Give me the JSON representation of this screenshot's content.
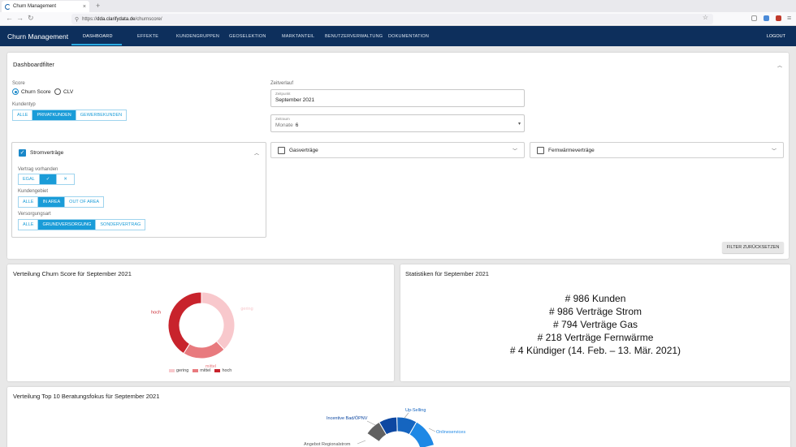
{
  "browser": {
    "tab_title": "Churn Management",
    "tab_close": "×",
    "new_tab": "+",
    "url_prefix": "https://",
    "url_domain": "dda.clarifydata.de",
    "url_path": "/churnscore/"
  },
  "nav": {
    "brand": "Churn Management",
    "items": [
      "DASHBOARD",
      "EFFEKTE",
      "KUNDENGRUPPEN",
      "GEOSELEKTION",
      "MARKTANTEIL",
      "BENUTZERVERWALTUNG",
      "DOKUMENTATION"
    ],
    "logout": "LOGOUT"
  },
  "filter": {
    "title": "Dashboardfilter",
    "score_label": "Score",
    "score_options": [
      "Churn Score",
      "CLV"
    ],
    "score_selected": "Churn Score",
    "kundentyp_label": "Kundentyp",
    "kundentyp_options": [
      "ALLE",
      "PRIVATKUNDEN",
      "GEWERBEKUNDEN"
    ],
    "kundentyp_selected": "PRIVATKUNDEN",
    "zeitverlauf_label": "Zeitverlauf",
    "zeitpunkt_label": "Zeitpunkt",
    "zeitpunkt_value": "September 2021",
    "zeitraum_label": "Zeitraum",
    "zeitraum_prefix": "Monate",
    "zeitraum_value": "6",
    "strom": {
      "title": "Stromverträge",
      "checked": true,
      "vertrag_label": "Vertrag vorhanden",
      "vertrag_options": [
        "EGAL",
        "✓",
        "✕"
      ],
      "vertrag_selected": "✓",
      "gebiet_label": "Kundengebiet",
      "gebiet_options": [
        "ALLE",
        "IN AREA",
        "OUT OF AREA"
      ],
      "gebiet_selected": "IN AREA",
      "versorgung_label": "Versorgungsart",
      "versorgung_options": [
        "ALLE",
        "GRUNDVERSORGUNG",
        "SONDERVERTRAG"
      ],
      "versorgung_selected": "GRUNDVERSORGUNG"
    },
    "gas": {
      "title": "Gasverträge",
      "checked": false
    },
    "fernwaerme": {
      "title": "Fernwärmeverträge",
      "checked": false
    },
    "reset_label": "FILTER ZURÜCKSETZEN"
  },
  "churn_card": {
    "title": "Verteilung Churn Score für September 2021"
  },
  "stats_card": {
    "title": "Statistiken für September 2021",
    "lines": [
      "# 986 Kunden",
      "# 986 Verträge Strom",
      "# 794 Verträge Gas",
      "# 218 Verträge Fernwärme",
      "# 4 Kündiger (14. Feb. – 13. Mär. 2021)"
    ]
  },
  "top10_card": {
    "title": "Verteilung Top 10 Beratungsfokus für September 2021"
  },
  "chart_data": [
    {
      "type": "pie",
      "title": "Verteilung Churn Score für September 2021",
      "categories": [
        "gering",
        "mittel",
        "hoch"
      ],
      "values": [
        38,
        21,
        41
      ],
      "colors": [
        "#f8c8cc",
        "#e87a7e",
        "#c8232c"
      ],
      "legend": "bottom"
    },
    {
      "type": "pie",
      "title": "Verteilung Top 10 Beratungsfokus für September 2021",
      "visible_labels": [
        "Incentive Bad/ÖPNV",
        "Up-Selling",
        "Onlineservices",
        "Angebot Regionalstrom"
      ],
      "colors": [
        "#0d47a1",
        "#1565c0",
        "#1e88e5",
        "#616161"
      ]
    }
  ]
}
